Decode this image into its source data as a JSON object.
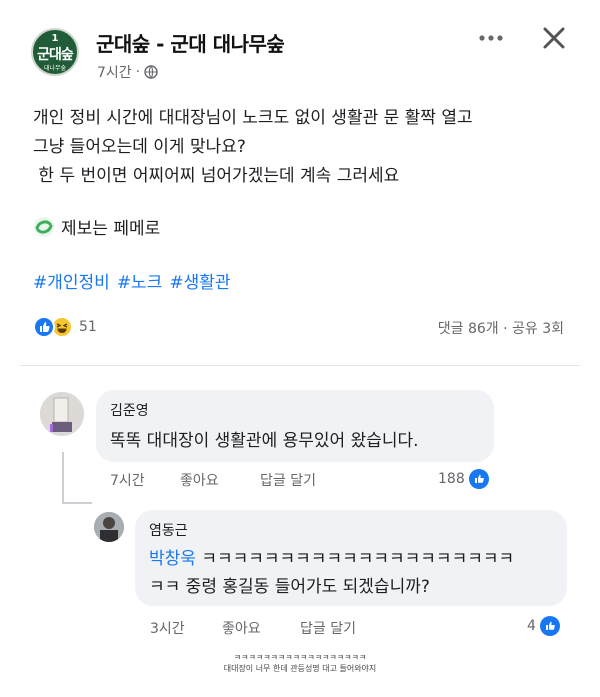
{
  "header": {
    "page_name": "군대숲 - 군대 대나무숲",
    "logo": {
      "number": "1",
      "name": "군대숲",
      "sub": "대나무숲"
    },
    "time": "7시간",
    "visibility_icon": "globe-icon",
    "more_icon": "more-horizontal-icon",
    "close_icon": "close-icon"
  },
  "post": {
    "lines": [
      "개인 정비 시간에 대대장님이 노크도 없이 생활관 문 활짝 열고",
      "그냥 들어오는데 이게 맞나요?",
      " 한 두 번이면 어찌어찌 넘어가겠는데 계속 그러세요"
    ],
    "tip_text": "제보는 페메로",
    "hashtags": [
      "#개인정비",
      "#노크",
      "#생활관"
    ]
  },
  "stats": {
    "reaction_count": "51",
    "comments_shares": "댓글 86개 · 공유 3회"
  },
  "comments": [
    {
      "author": "김준영",
      "text": "똑똑 대대장이 생활관에 용무있어 왔습니다.",
      "time": "7시간",
      "like_label": "좋아요",
      "reply_label": "답글 달기",
      "likes": "188"
    },
    {
      "author": "염동근",
      "mention": "박창욱",
      "text_line1": " ㅋㅋㅋㅋㅋㅋㅋㅋㅋㅋㅋㅋㅋㅋㅋㅋㅋㅋㅋㅋ",
      "text_line2": "ㅋㅋ 중령 홍길동 들어가도 되겠습니까?",
      "time": "3시간",
      "like_label": "좋아요",
      "reply_label": "답글 달기",
      "likes": "4"
    }
  ],
  "caption": {
    "line1": "ㅋㅋㅋㅋㅋㅋㅋㅋㅋㅋㅋㅋㅋㅋㅋㅋㅋㅋ",
    "line2": "대대장이 너무 한데 관등성명 대고 들어와야지"
  },
  "colors": {
    "accent": "#1877f2",
    "logo_green": "#1f5c37",
    "bubble": "#f0f2f5",
    "meta": "#65676b"
  }
}
